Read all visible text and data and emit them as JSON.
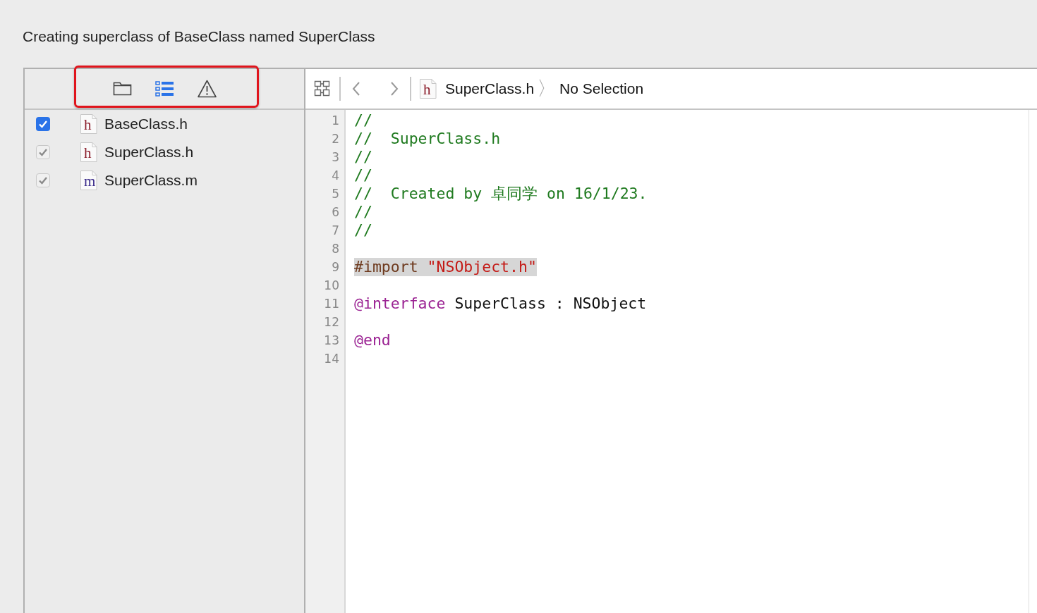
{
  "window": {
    "title": "Creating superclass of BaseClass named SuperClass"
  },
  "navigator": {
    "scope_tabs": [
      {
        "kind": "folder",
        "selected": false
      },
      {
        "kind": "list",
        "selected": true
      },
      {
        "kind": "warning",
        "selected": false
      }
    ],
    "files": [
      {
        "name": "BaseClass.h",
        "icon_letter": "h",
        "checked": true,
        "disabled": false
      },
      {
        "name": "SuperClass.h",
        "icon_letter": "h",
        "checked": true,
        "disabled": true
      },
      {
        "name": "SuperClass.m",
        "icon_letter": "m",
        "checked": true,
        "disabled": true
      }
    ]
  },
  "editor": {
    "jump_bar": {
      "file_icon_letter": "h",
      "file": "SuperClass.h",
      "separator": "〉",
      "symbol": "No Selection"
    },
    "lines": [
      {
        "number": "1",
        "tokens": [
          {
            "kind": "comment",
            "text": "//"
          }
        ]
      },
      {
        "number": "2",
        "tokens": [
          {
            "kind": "comment",
            "text": "//  SuperClass.h"
          }
        ]
      },
      {
        "number": "3",
        "tokens": [
          {
            "kind": "comment",
            "text": "//"
          }
        ]
      },
      {
        "number": "4",
        "tokens": [
          {
            "kind": "comment",
            "text": "//"
          }
        ]
      },
      {
        "number": "5",
        "tokens": [
          {
            "kind": "comment",
            "text": "//  Created by 卓同学 on 16/1/23."
          }
        ]
      },
      {
        "number": "6",
        "tokens": [
          {
            "kind": "comment",
            "text": "//"
          }
        ]
      },
      {
        "number": "7",
        "tokens": [
          {
            "kind": "comment",
            "text": "//"
          }
        ]
      },
      {
        "number": "8"
      },
      {
        "number": "9",
        "highlighted": true,
        "tokens": [
          {
            "kind": "preprocessor",
            "text": "#import "
          },
          {
            "kind": "string",
            "text": "\"NSObject.h\""
          }
        ]
      },
      {
        "number": "10"
      },
      {
        "number": "11",
        "tokens": [
          {
            "kind": "keyword",
            "text": "@interface"
          },
          {
            "kind": "plain",
            "text": " SuperClass : NSObject"
          }
        ]
      },
      {
        "number": "12"
      },
      {
        "number": "13",
        "tokens": [
          {
            "kind": "keyword",
            "text": "@end"
          }
        ]
      },
      {
        "number": "14"
      }
    ]
  }
}
